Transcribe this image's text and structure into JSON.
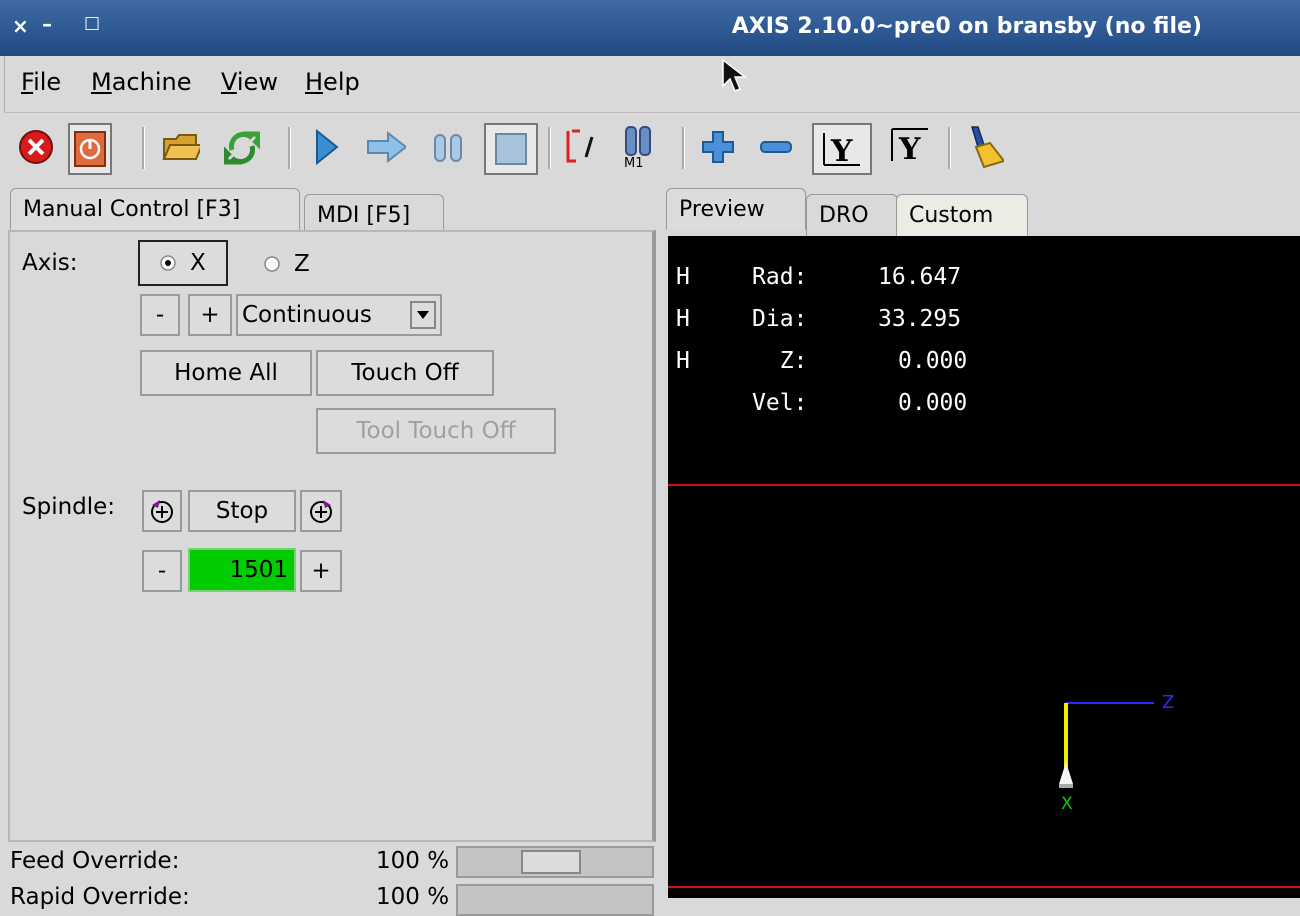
{
  "window": {
    "title": "AXIS 2.10.0~pre0 on bransby (no file)",
    "controls": [
      "×",
      "–",
      "□"
    ]
  },
  "menu": [
    {
      "label": "File",
      "ul": "F",
      "rest": "ile"
    },
    {
      "label": "Machine",
      "ul": "M",
      "rest": "achine"
    },
    {
      "label": "View",
      "ul": "V",
      "rest": "iew"
    },
    {
      "label": "Help",
      "ul": "H",
      "rest": "elp"
    }
  ],
  "toolbar_icons": [
    "estop-icon",
    "machine-power-icon",
    "open-file-icon",
    "reload-icon",
    "run-icon",
    "step-icon",
    "pause-icon",
    "stop-icon",
    "block-delete-icon",
    "optional-stop-icon",
    "zoom-in-icon",
    "zoom-out-icon",
    "view-y-icon",
    "view-y2-icon",
    "clear-plot-icon"
  ],
  "left_tabs": [
    {
      "label": "Manual Control [F3]"
    },
    {
      "label": "MDI [F5]"
    }
  ],
  "right_tabs": [
    {
      "label": "Preview"
    },
    {
      "label": "DRO"
    },
    {
      "label": "Custom"
    }
  ],
  "manual": {
    "axis_label": "Axis:",
    "axis_x": "X",
    "axis_z": "Z",
    "minus": "-",
    "plus": "+",
    "jog_mode": "Continuous",
    "home_all": "Home All",
    "touch_off": "Touch Off",
    "tool_touch_off": "Tool Touch Off",
    "spindle_label": "Spindle:",
    "spindle_stop": "Stop",
    "spindle_speed": "1501"
  },
  "overrides": {
    "feed_label": "Feed Override:",
    "feed_value": "100 %",
    "feed_fraction": 0.47,
    "rapid_label": "Rapid Override:",
    "rapid_value": "100 %"
  },
  "dro": [
    {
      "flag": "H",
      "name": "Rad:",
      "value": "16.647"
    },
    {
      "flag": "H",
      "name": "Dia:",
      "value": "33.295"
    },
    {
      "flag": "H",
      "name": "  Z:",
      "value": "0.000"
    },
    {
      "flag": "",
      "name": "Vel:",
      "value": "0.000"
    }
  ],
  "preview_axes": {
    "z_label": "Z",
    "x_label": "X"
  },
  "colors": {
    "limit_line": "#d01010",
    "z_axis": "#2a2aff",
    "x_axis": "#f0f000",
    "x_label": "#00d000",
    "spindle_ok": "#00cc00"
  }
}
